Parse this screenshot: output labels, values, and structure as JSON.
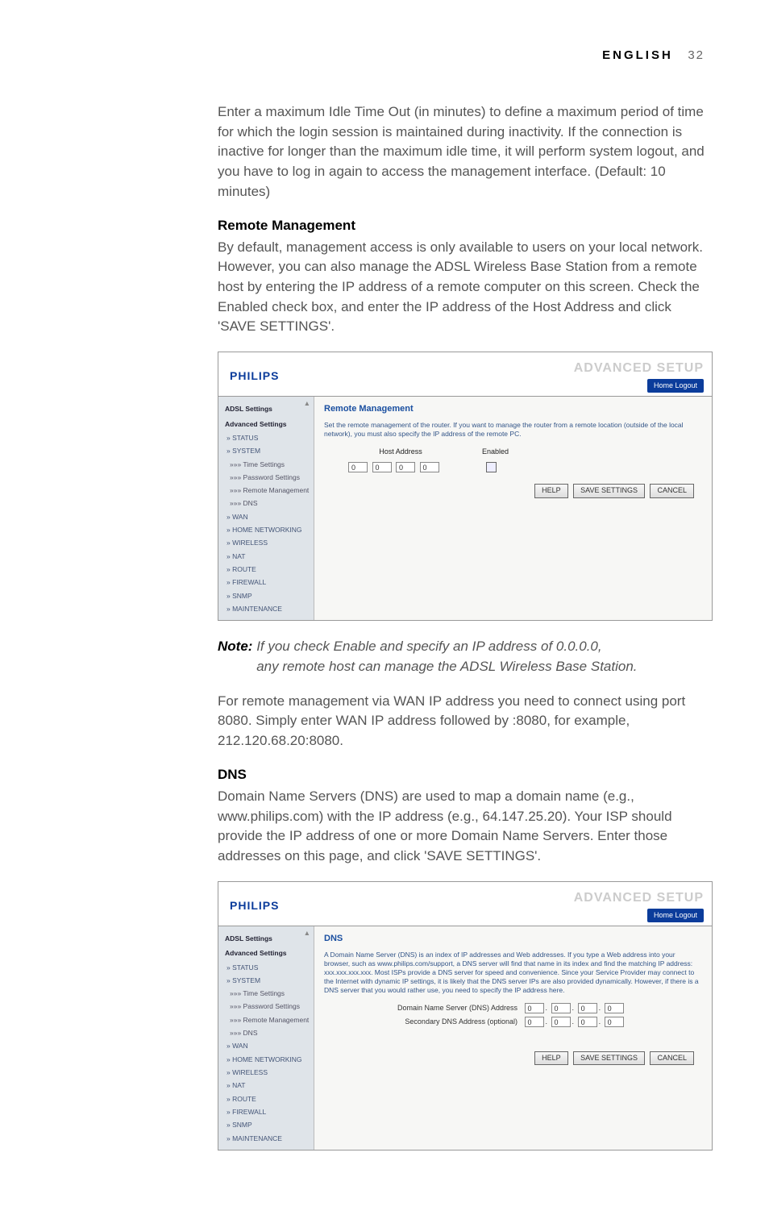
{
  "header": {
    "lang": "ENGLISH",
    "page_no": "32"
  },
  "para1": "Enter a maximum Idle Time Out (in minutes) to define a maximum period of time for which the login session is maintained during inactivity. If the connection is inactive for longer than the maximum idle time, it will perform system logout, and you have to log in again to access the management interface. (Default: 10 minutes)",
  "sec_remote": {
    "title": "Remote Management",
    "body": "By default, management access is only available to users on your local network. However, you can also manage the ADSL Wireless Base Station from a remote host by entering the IP address of a remote computer on this screen. Check the Enabled check box, and enter the IP address of the Host Address and click 'SAVE SETTINGS'."
  },
  "note": {
    "label": "Note:",
    "line1": "If you check Enable and specify an IP address of 0.0.0.0,",
    "line2": "any remote host can manage the ADSL Wireless Base Station."
  },
  "para_remote2": "For remote management via WAN IP address you need to connect using port 8080. Simply enter WAN IP address followed by :8080, for example, 212.120.68.20:8080.",
  "sec_dns": {
    "title": "DNS",
    "body": "Domain Name Servers (DNS) are used to map a domain name (e.g., www.philips.com) with the IP address (e.g., 64.147.25.20). Your ISP should provide the IP address of one or more Domain Name Servers. Enter those addresses on this page, and click 'SAVE SETTINGS'."
  },
  "ss_common": {
    "logo": "PHILIPS",
    "adv": "ADVANCED SETUP",
    "home_logout": "Home  Logout",
    "buttons": {
      "help": "HELP",
      "save": "SAVE SETTINGS",
      "cancel": "CANCEL"
    },
    "sidebar": {
      "grp1": "ADSL Settings",
      "grp2": "Advanced Settings",
      "items": [
        "» STATUS",
        "» SYSTEM",
        "»»» Time Settings",
        "»»» Password Settings",
        "»»» Remote Management",
        "»»» DNS",
        "» WAN",
        "» HOME NETWORKING",
        "» WIRELESS",
        "» NAT",
        "» ROUTE",
        "» FIREWALL",
        "» SNMP",
        "» MAINTENANCE"
      ]
    }
  },
  "ss1": {
    "title": "Remote Management",
    "desc": "Set the remote management of the router. If you want to manage the router from a remote location (outside of the local network), you must also specify the IP address of the remote PC.",
    "col_host": "Host Address",
    "col_enabled": "Enabled",
    "ip": [
      "0",
      "0",
      "0",
      "0"
    ]
  },
  "ss2": {
    "title": "DNS",
    "desc": "A Domain Name Server (DNS) is an index of IP addresses and Web addresses. If you type a Web address into your browser, such as www.philips.com/support, a DNS server will find that name in its index and find the matching IP address: xxx.xxx.xxx.xxx. Most ISPs provide a DNS server for speed and convenience. Since your Service Provider may connect to the Internet with dynamic IP settings, it is likely that the DNS server IPs are also provided dynamically. However, if there is a DNS server that you would rather use, you need to specify the IP address here.",
    "row1": "Domain Name Server (DNS) Address",
    "row2": "Secondary DNS Address (optional)",
    "ip1": [
      "0",
      "0",
      "0",
      "0"
    ],
    "ip2": [
      "0",
      "0",
      "0",
      "0"
    ]
  }
}
